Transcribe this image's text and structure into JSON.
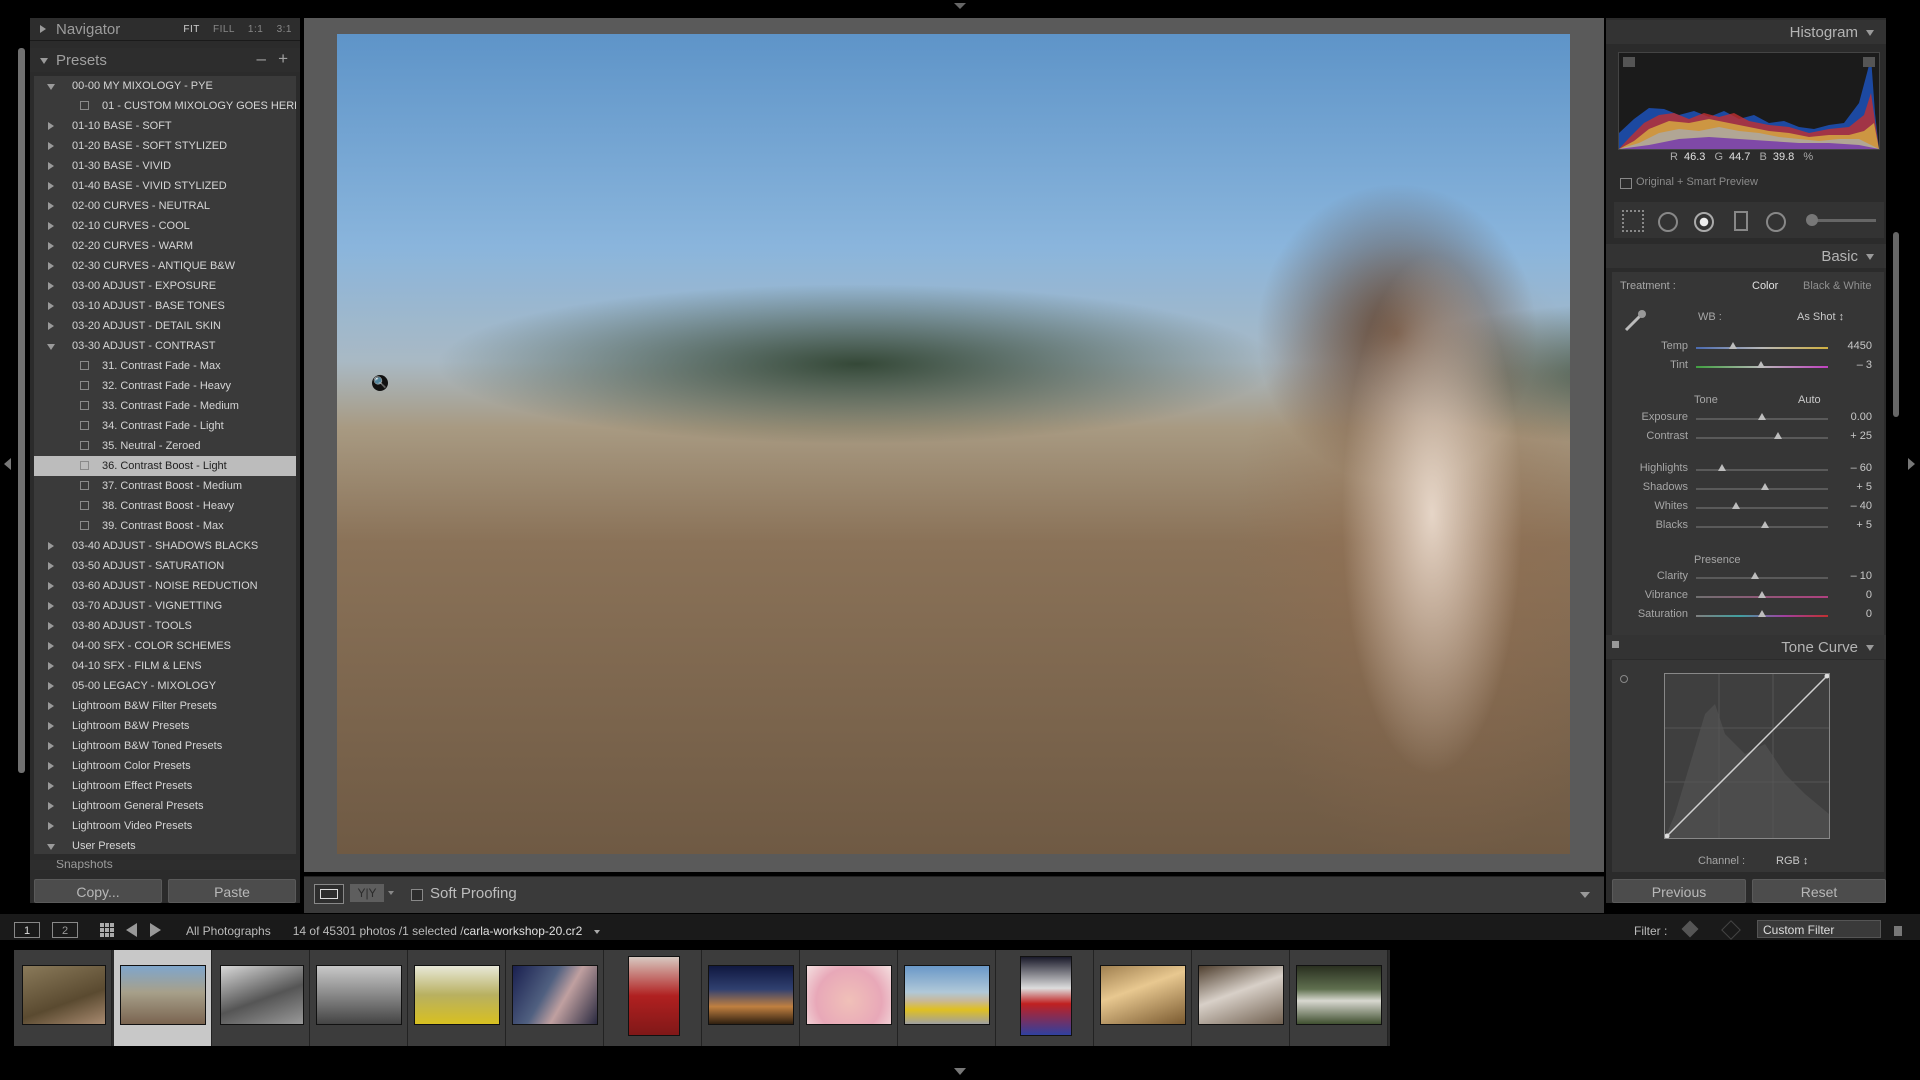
{
  "navigator": {
    "title": "Navigator",
    "options": [
      "FIT",
      "FILL",
      "1:1",
      "3:1"
    ]
  },
  "presets": {
    "title": "Presets",
    "minus": "–",
    "plus": "+",
    "items": [
      {
        "label": "00-00 MY MIXOLOGY - PYE",
        "level": 0,
        "open": true
      },
      {
        "label": "01 - CUSTOM MIXOLOGY GOES HERE",
        "level": 1
      },
      {
        "label": "01-10 BASE - SOFT",
        "level": 0
      },
      {
        "label": "01-20 BASE - SOFT STYLIZED",
        "level": 0
      },
      {
        "label": "01-30 BASE - VIVID",
        "level": 0
      },
      {
        "label": "01-40 BASE - VIVID STYLIZED",
        "level": 0
      },
      {
        "label": "02-00 CURVES - NEUTRAL",
        "level": 0
      },
      {
        "label": "02-10 CURVES - COOL",
        "level": 0
      },
      {
        "label": "02-20 CURVES - WARM",
        "level": 0
      },
      {
        "label": "02-30 CURVES - ANTIQUE B&W",
        "level": 0
      },
      {
        "label": "03-00 ADJUST - EXPOSURE",
        "level": 0
      },
      {
        "label": "03-10 ADJUST - BASE TONES",
        "level": 0
      },
      {
        "label": "03-20 ADJUST - DETAIL SKIN",
        "level": 0
      },
      {
        "label": "03-30 ADJUST - CONTRAST",
        "level": 0,
        "open": true
      },
      {
        "label": "31. Contrast Fade - Max",
        "level": 1
      },
      {
        "label": "32. Contrast Fade - Heavy",
        "level": 1
      },
      {
        "label": "33. Contrast Fade - Medium",
        "level": 1
      },
      {
        "label": "34. Contrast Fade - Light",
        "level": 1
      },
      {
        "label": "35. Neutral - Zeroed",
        "level": 1
      },
      {
        "label": "36. Contrast Boost - Light",
        "level": 1,
        "selected": true
      },
      {
        "label": "37. Contrast Boost - Medium",
        "level": 1
      },
      {
        "label": "38. Contrast Boost - Heavy",
        "level": 1
      },
      {
        "label": "39. Contrast Boost - Max",
        "level": 1
      },
      {
        "label": "03-40 ADJUST - SHADOWS BLACKS",
        "level": 0
      },
      {
        "label": "03-50 ADJUST - SATURATION",
        "level": 0
      },
      {
        "label": "03-60 ADJUST - NOISE REDUCTION",
        "level": 0
      },
      {
        "label": "03-70 ADJUST - VIGNETTING",
        "level": 0
      },
      {
        "label": "03-80 ADJUST - TOOLS",
        "level": 0
      },
      {
        "label": "04-00 SFX - COLOR SCHEMES",
        "level": 0
      },
      {
        "label": "04-10 SFX - FILM & LENS",
        "level": 0
      },
      {
        "label": "05-00 LEGACY - MIXOLOGY",
        "level": 0
      },
      {
        "label": "Lightroom B&W Filter Presets",
        "level": 0
      },
      {
        "label": "Lightroom B&W Presets",
        "level": 0
      },
      {
        "label": "Lightroom B&W Toned Presets",
        "level": 0
      },
      {
        "label": "Lightroom Color Presets",
        "level": 0
      },
      {
        "label": "Lightroom Effect Presets",
        "level": 0
      },
      {
        "label": "Lightroom General Presets",
        "level": 0
      },
      {
        "label": "Lightroom Video Presets",
        "level": 0
      },
      {
        "label": "User Presets",
        "level": 0,
        "open": true
      }
    ]
  },
  "snapshots": {
    "title": "Snapshots"
  },
  "left_buttons": {
    "copy": "Copy...",
    "paste": "Paste"
  },
  "toolbar": {
    "yy": "Y|Y",
    "soft_proofing": "Soft Proofing"
  },
  "histogram": {
    "title": "Histogram",
    "r_label": "R",
    "r_value": "46.3",
    "g_label": "G",
    "g_value": "44.7",
    "b_label": "B",
    "b_value": "39.8",
    "pct": "%",
    "preview": "Original + Smart Preview"
  },
  "basic": {
    "title": "Basic",
    "treatment_label": "Treatment :",
    "treatment_color": "Color",
    "treatment_bw": "Black & White",
    "wb_label": "WB :",
    "wb_value": "As Shot ↕",
    "tone_label": "Tone",
    "auto": "Auto",
    "presence_label": "Presence",
    "sliders": [
      {
        "label": "Temp",
        "value": "4450",
        "level": 0.28,
        "kind": "temp"
      },
      {
        "label": "Tint",
        "value": "– 3",
        "level": 0.49,
        "kind": "tint"
      },
      {
        "label": "Exposure",
        "value": "0.00",
        "level": 0.5
      },
      {
        "label": "Contrast",
        "value": "+ 25",
        "level": 0.62
      },
      {
        "label": "Highlights",
        "value": "– 60",
        "level": 0.2
      },
      {
        "label": "Shadows",
        "value": "+ 5",
        "level": 0.52
      },
      {
        "label": "Whites",
        "value": "– 40",
        "level": 0.3
      },
      {
        "label": "Blacks",
        "value": "+ 5",
        "level": 0.52
      },
      {
        "label": "Clarity",
        "value": "– 10",
        "level": 0.45
      },
      {
        "label": "Vibrance",
        "value": "0",
        "level": 0.5,
        "kind": "vib"
      },
      {
        "label": "Saturation",
        "value": "0",
        "level": 0.5,
        "kind": "sat"
      }
    ]
  },
  "tone_curve": {
    "title": "Tone Curve",
    "channel_label": "Channel :",
    "channel_value": "RGB ↕"
  },
  "right_buttons": {
    "previous": "Previous",
    "reset": "Reset"
  },
  "filmstrip_bar": {
    "page1": "1",
    "page2": "2",
    "source": "All Photographs",
    "count": "14 of 45301 photos /1 selected /",
    "filename": "carla-workshop-20.cr2",
    "filter_label": "Filter :",
    "filter_value": "Custom Filter"
  },
  "colors": {
    "panel": "#2b2b2b",
    "selected_row": "#bcbcbc",
    "accent": "#c8c8c8"
  }
}
